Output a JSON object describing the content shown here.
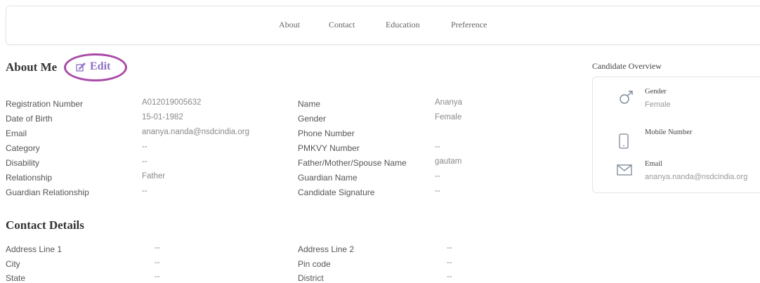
{
  "tabs": [
    "About",
    "Contact",
    "Education",
    "Preference"
  ],
  "about": {
    "title": "About Me",
    "edit_label": "Edit",
    "left_fields": [
      {
        "label": "Registration Number",
        "value": "A012019005632"
      },
      {
        "label": "Date of Birth",
        "value": "15-01-1982"
      },
      {
        "label": "Email",
        "value": "ananya.nanda@nsdcindia.org"
      },
      {
        "label": "Category",
        "value": "--"
      },
      {
        "label": "Disability",
        "value": "--"
      },
      {
        "label": "Relationship",
        "value": "Father"
      },
      {
        "label": "Guardian Relationship",
        "value": "--"
      }
    ],
    "right_fields": [
      {
        "label": "Name",
        "value": "Ananya"
      },
      {
        "label": "Gender",
        "value": "Female"
      },
      {
        "label": "Phone Number",
        "value": ""
      },
      {
        "label": "PMKVY Number",
        "value": "--"
      },
      {
        "label": "Father/Mother/Spouse Name",
        "value": "gautam"
      },
      {
        "label": "Guardian Name",
        "value": "--"
      },
      {
        "label": "Candidate Signature",
        "value": "--"
      }
    ]
  },
  "contact": {
    "title": "Contact Details",
    "left_fields": [
      {
        "label": "Address Line 1",
        "value": "--"
      },
      {
        "label": "City",
        "value": "--"
      },
      {
        "label": "State",
        "value": "--"
      }
    ],
    "right_fields": [
      {
        "label": "Address Line 2",
        "value": "--"
      },
      {
        "label": "Pin code",
        "value": "--"
      },
      {
        "label": "District",
        "value": "--"
      }
    ]
  },
  "overview": {
    "title": "Candidate Overview",
    "items": [
      {
        "icon": "male-gender-icon",
        "label": "Gender",
        "value": "Female"
      },
      {
        "icon": "mobile-phone-icon",
        "label": "Mobile Number",
        "value": ""
      },
      {
        "icon": "mail-envelope-icon",
        "label": "Email",
        "value": "ananya.nanda@nsdcindia.org"
      }
    ]
  },
  "colors": {
    "edit_accent": "#8a6fc4",
    "highlight_circle": "#a94aa8",
    "label_text": "#555555",
    "value_text": "#8a8a8a"
  }
}
